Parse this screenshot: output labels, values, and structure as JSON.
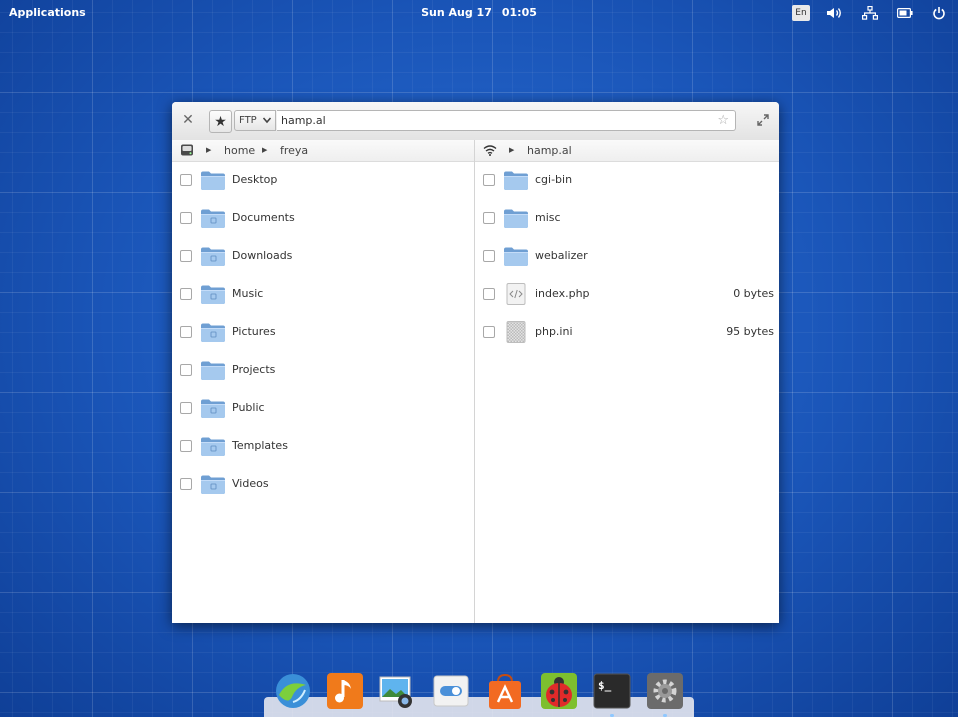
{
  "panel": {
    "applications_label": "Applications",
    "date": "Sun Aug 17",
    "time": "01:05",
    "keyboard_layout": "En"
  },
  "window": {
    "protocol": "FTP",
    "address": "hamp.al",
    "left_pane": {
      "breadcrumb": [
        "home",
        "freya"
      ],
      "items": [
        {
          "name": "Desktop",
          "kind": "folder",
          "emblem": ""
        },
        {
          "name": "Documents",
          "kind": "folder",
          "emblem": "document"
        },
        {
          "name": "Downloads",
          "kind": "folder",
          "emblem": "download"
        },
        {
          "name": "Music",
          "kind": "folder",
          "emblem": "music"
        },
        {
          "name": "Pictures",
          "kind": "folder",
          "emblem": "picture"
        },
        {
          "name": "Projects",
          "kind": "folder",
          "emblem": ""
        },
        {
          "name": "Public",
          "kind": "folder",
          "emblem": "share"
        },
        {
          "name": "Templates",
          "kind": "folder",
          "emblem": "template"
        },
        {
          "name": "Videos",
          "kind": "folder",
          "emblem": "video"
        }
      ]
    },
    "right_pane": {
      "breadcrumb": [
        "hamp.al"
      ],
      "items": [
        {
          "name": "cgi-bin",
          "kind": "folder",
          "size": ""
        },
        {
          "name": "misc",
          "kind": "folder",
          "size": ""
        },
        {
          "name": "webalizer",
          "kind": "folder",
          "size": ""
        },
        {
          "name": "index.php",
          "kind": "code",
          "size": "0 bytes"
        },
        {
          "name": "php.ini",
          "kind": "text",
          "size": "95 bytes"
        }
      ]
    }
  },
  "dock": {
    "apps": [
      {
        "name": "midori-browser-icon",
        "running": false
      },
      {
        "name": "noise-music-icon",
        "running": false
      },
      {
        "name": "shotwell-photos-icon",
        "running": false
      },
      {
        "name": "switchboard-settings-icon",
        "running": false
      },
      {
        "name": "software-center-icon",
        "running": false
      },
      {
        "name": "ladybug-app-icon",
        "running": false
      },
      {
        "name": "terminal-icon",
        "running": true
      },
      {
        "name": "system-settings-icon",
        "running": true
      }
    ]
  },
  "colors": {
    "desktop_blue": "#1a55b8",
    "folder_blue": "#8db8e4",
    "dock_running_dot": "#8fc8ff"
  }
}
